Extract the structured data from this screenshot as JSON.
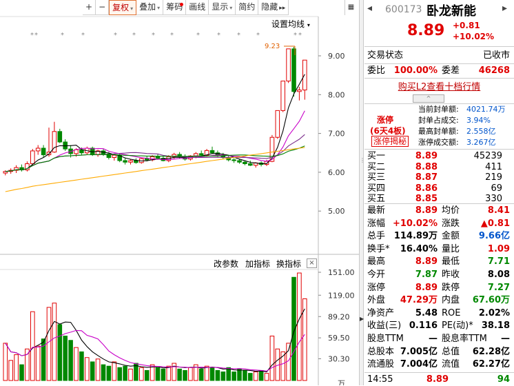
{
  "toolbar": {
    "items": [
      {
        "label": "+"
      },
      {
        "label": "−"
      },
      {
        "label": "复权",
        "dropdown": true,
        "active": true
      },
      {
        "label": "叠加",
        "dropdown": true
      },
      {
        "label": "筹码",
        "dot": true
      },
      {
        "label": "画线"
      },
      {
        "label": "显示",
        "dropdown": true
      },
      {
        "label": "简约"
      },
      {
        "label": "隐藏"
      }
    ],
    "hide_arrow": "▸▸",
    "corner": "▦"
  },
  "chart": {
    "settings_label": "设置均线",
    "high_marker": "9.23",
    "price_axis": [
      "9.00",
      "8.00",
      "7.00",
      "6.00",
      "5.00"
    ],
    "volume_axis": [
      "151.00",
      "119.00",
      "89.20",
      "59.50",
      "30.30",
      "万"
    ],
    "indicator_buttons": [
      "改参数",
      "加指标",
      "换指标"
    ],
    "close_label": "×",
    "colors": {
      "up": "#e00000",
      "down": "#008800",
      "ma5": "#000000",
      "ma10": "#c800c8",
      "ma20": "#7a2c8a",
      "ma60": "#008000",
      "ma120": "#ffaa00"
    },
    "candles": [
      [
        5.98,
        6.05,
        5.92,
        6.02
      ],
      [
        6.02,
        6.1,
        5.96,
        6.05
      ],
      [
        6.05,
        6.18,
        5.98,
        6.12
      ],
      [
        6.12,
        6.2,
        6.02,
        6.06
      ],
      [
        6.06,
        6.28,
        6.02,
        6.22
      ],
      [
        6.22,
        6.6,
        6.18,
        6.55
      ],
      [
        6.55,
        6.7,
        6.45,
        6.62
      ],
      [
        6.62,
        6.7,
        6.38,
        6.45
      ],
      [
        6.45,
        7.15,
        6.4,
        6.52
      ],
      [
        6.52,
        7.3,
        6.5,
        7.05
      ],
      [
        7.05,
        7.12,
        6.75,
        6.78
      ],
      [
        6.78,
        6.85,
        6.55,
        6.6
      ],
      [
        6.6,
        6.7,
        6.38,
        6.48
      ],
      [
        6.48,
        6.62,
        6.4,
        6.58
      ],
      [
        6.58,
        6.64,
        6.45,
        6.5
      ],
      [
        6.5,
        6.66,
        6.46,
        6.62
      ],
      [
        6.62,
        6.66,
        6.42,
        6.45
      ],
      [
        6.45,
        6.58,
        6.4,
        6.55
      ],
      [
        6.55,
        6.6,
        6.42,
        6.47
      ],
      [
        6.47,
        6.52,
        6.33,
        6.38
      ],
      [
        6.38,
        6.48,
        6.3,
        6.44
      ],
      [
        6.44,
        6.48,
        6.26,
        6.3
      ],
      [
        6.3,
        6.36,
        6.2,
        6.26
      ],
      [
        6.26,
        6.34,
        6.2,
        6.3
      ],
      [
        6.3,
        6.36,
        6.22,
        6.25
      ],
      [
        6.25,
        6.38,
        6.22,
        6.35
      ],
      [
        6.35,
        6.42,
        6.28,
        6.32
      ],
      [
        6.32,
        6.44,
        6.28,
        6.4
      ],
      [
        6.4,
        6.46,
        6.32,
        6.36
      ],
      [
        6.36,
        6.42,
        6.28,
        6.3
      ],
      [
        6.3,
        6.44,
        6.26,
        6.4
      ],
      [
        6.4,
        6.5,
        6.34,
        6.46
      ],
      [
        6.46,
        6.52,
        6.36,
        6.4
      ],
      [
        6.4,
        6.46,
        6.3,
        6.34
      ],
      [
        6.34,
        6.44,
        6.3,
        6.42
      ],
      [
        6.42,
        6.52,
        6.36,
        6.48
      ],
      [
        6.48,
        6.56,
        6.4,
        6.44
      ],
      [
        6.44,
        6.6,
        6.4,
        6.56
      ],
      [
        6.56,
        6.66,
        6.48,
        6.5
      ],
      [
        6.5,
        6.56,
        6.4,
        6.44
      ],
      [
        6.44,
        6.5,
        6.34,
        6.38
      ],
      [
        6.38,
        6.42,
        6.28,
        6.32
      ],
      [
        6.32,
        6.36,
        6.24,
        6.3
      ],
      [
        6.3,
        6.34,
        6.22,
        6.26
      ],
      [
        6.26,
        6.3,
        6.18,
        6.22
      ],
      [
        6.22,
        6.3,
        6.16,
        6.18
      ],
      [
        6.18,
        6.26,
        6.12,
        6.24
      ],
      [
        6.24,
        6.28,
        6.15,
        6.2
      ],
      [
        6.2,
        6.32,
        6.16,
        6.28
      ],
      [
        6.28,
        6.96,
        6.26,
        6.9
      ],
      [
        6.9,
        7.59,
        6.86,
        7.59
      ],
      [
        7.59,
        8.35,
        7.55,
        8.35
      ],
      [
        8.35,
        9.18,
        8.3,
        9.18
      ],
      [
        9.18,
        9.23,
        7.95,
        8.08
      ],
      [
        8.08,
        8.2,
        7.85,
        8.12
      ],
      [
        8.12,
        8.89,
        7.87,
        8.89
      ]
    ],
    "volumes": [
      52,
      28,
      36,
      22,
      44,
      96,
      48,
      58,
      102,
      108,
      78,
      62,
      56,
      46,
      40,
      32,
      26,
      30,
      22,
      20,
      26,
      18,
      20,
      16,
      24,
      18,
      14,
      22,
      18,
      16,
      20,
      24,
      16,
      14,
      18,
      22,
      16,
      20,
      18,
      14,
      12,
      18,
      12,
      16,
      14,
      10,
      12,
      14,
      10,
      62,
      44,
      40,
      52,
      144,
      150,
      114
    ],
    "ma120": [
      5.5,
      5.53,
      5.56,
      5.58,
      5.61,
      5.64,
      5.66,
      5.68,
      5.7,
      5.72,
      5.74,
      5.76,
      5.78,
      5.8,
      5.82,
      5.84,
      5.86,
      5.88,
      5.9,
      5.92,
      5.94,
      5.96,
      5.98,
      6.0,
      6.02,
      6.04,
      6.06,
      6.08,
      6.1,
      6.12,
      6.14,
      6.16,
      6.18,
      6.2,
      6.22,
      6.24,
      6.26,
      6.28,
      6.3,
      6.32,
      6.34,
      6.36,
      6.38,
      6.4,
      6.42,
      6.44,
      6.46,
      6.48,
      6.5,
      6.52,
      6.54,
      6.56,
      6.58,
      6.6,
      6.62,
      6.64
    ]
  },
  "quote": {
    "code": "600173",
    "name": "卧龙新能",
    "price": "8.89",
    "change": "+0.81",
    "change_pct": "+10.02%",
    "status_label": "交易状态",
    "status_value": "已收市",
    "wb_label": "委比",
    "wb_value": "100.00%",
    "wc_label": "委差",
    "wc_value": "46268",
    "l2_link": "购买L2查看十档行情",
    "caret": "^",
    "limit_tag": "涨停",
    "limit_days": "(6天4板)",
    "limit_btn": "涨停揭秘",
    "seal": [
      {
        "label": "当前封单额:",
        "value": "4021.74万"
      },
      {
        "label": "封单占成交:",
        "value": "3.94%"
      },
      {
        "label": "最高封单额:",
        "value": "2.558亿"
      },
      {
        "label": "涨停成交额:",
        "value": "3.267亿"
      }
    ],
    "book": [
      {
        "label": "买一",
        "price": "8.89",
        "qty": "45239"
      },
      {
        "label": "买二",
        "price": "8.88",
        "qty": "411"
      },
      {
        "label": "买三",
        "price": "8.87",
        "qty": "219"
      },
      {
        "label": "买四",
        "price": "8.86",
        "qty": "69"
      },
      {
        "label": "买五",
        "price": "8.85",
        "qty": "330"
      }
    ],
    "stats": [
      {
        "l1": "最新",
        "v1": "8.89",
        "c1": "red",
        "l2": "均价",
        "v2": "8.41",
        "c2": "red"
      },
      {
        "l1": "涨幅",
        "v1": "+10.02%",
        "c1": "red",
        "l2": "涨跌",
        "v2": "▲0.81",
        "c2": "red"
      },
      {
        "l1": "总手",
        "v1": "114.89万",
        "c1": "",
        "l2": "金额",
        "v2": "9.66亿",
        "c2": "blue"
      },
      {
        "l1": "换手*",
        "v1": "16.40%",
        "c1": "",
        "l2": "量比",
        "v2": "1.09",
        "c2": "red"
      },
      {
        "l1": "最高",
        "v1": "8.89",
        "c1": "red",
        "l2": "最低",
        "v2": "7.71",
        "c2": "green"
      },
      {
        "l1": "今开",
        "v1": "7.87",
        "c1": "green",
        "l2": "昨收",
        "v2": "8.08",
        "c2": ""
      },
      {
        "l1": "涨停",
        "v1": "8.89",
        "c1": "red",
        "l2": "跌停",
        "v2": "7.27",
        "c2": "green"
      },
      {
        "l1": "外盘",
        "v1": "47.29万",
        "c1": "red",
        "l2": "内盘",
        "v2": "67.60万",
        "c2": "green"
      },
      {
        "l1": "净资产",
        "v1": "5.48",
        "c1": "",
        "l2": "ROE",
        "v2": "2.02%",
        "c2": ""
      },
      {
        "l1": "收益(三)",
        "v1": "0.116",
        "c1": "",
        "l2": "PE(动)*",
        "v2": "38.18",
        "c2": ""
      },
      {
        "l1": "股息TTM",
        "v1": "—",
        "c1": "",
        "l2": "股息率TTM",
        "v2": "—",
        "c2": ""
      },
      {
        "l1": "总股本",
        "v1": "7.005亿",
        "c1": "",
        "l2": "总值",
        "v2": "62.28亿",
        "c2": ""
      },
      {
        "l1": "流通股",
        "v1": "7.004亿",
        "c1": "",
        "l2": "流值",
        "v2": "62.27亿",
        "c2": ""
      }
    ],
    "last_trade": {
      "time": "14:55",
      "price": "8.89",
      "vol": "94"
    }
  }
}
